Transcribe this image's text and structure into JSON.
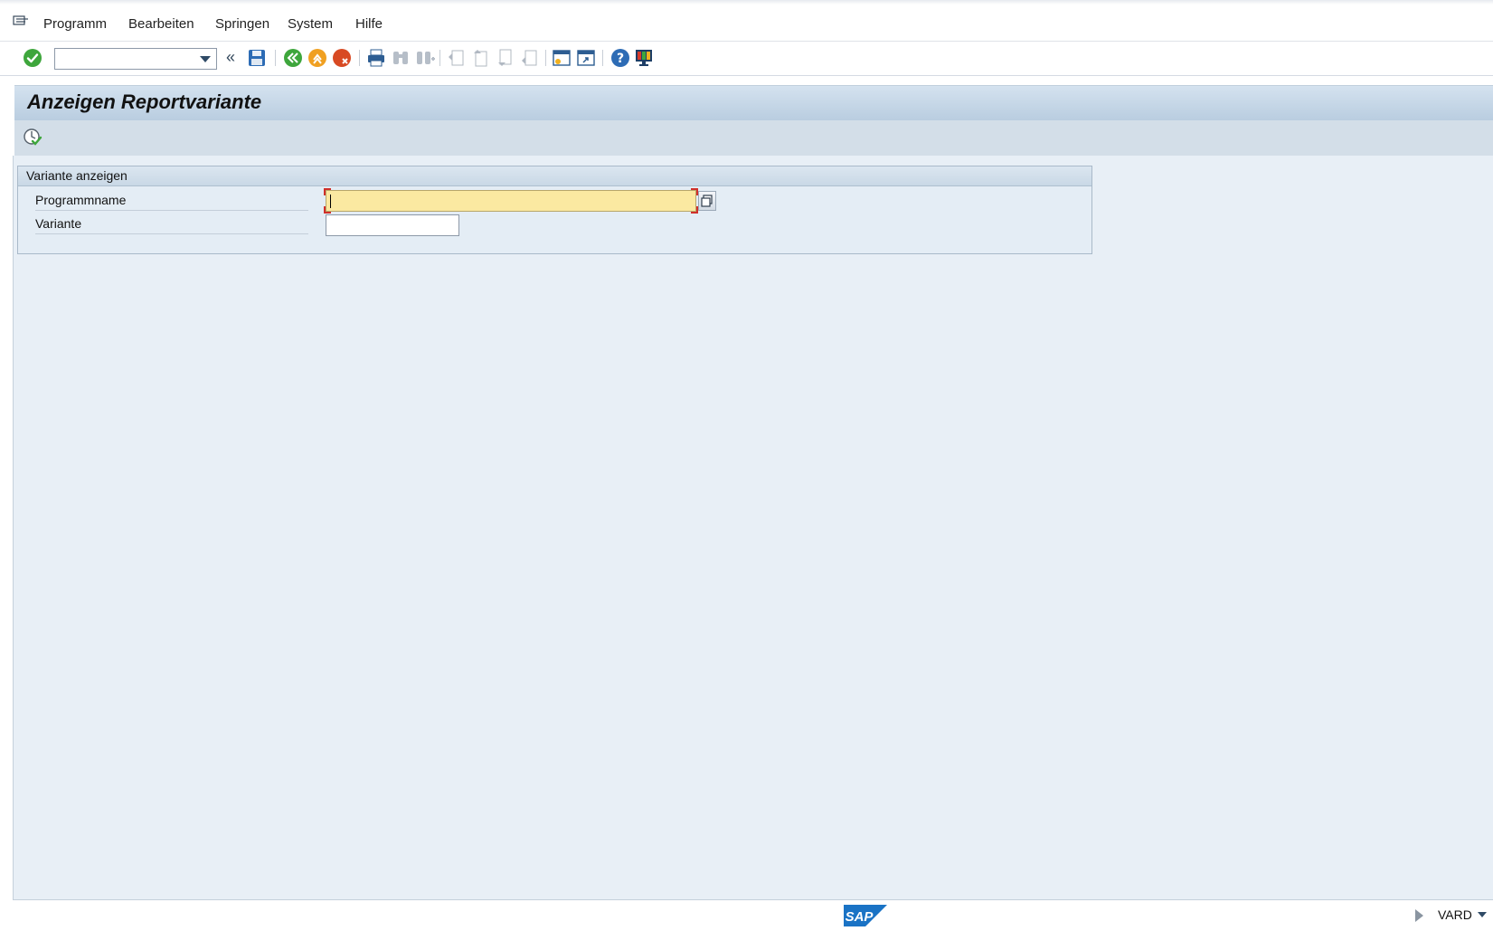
{
  "menu": {
    "items": [
      {
        "label": "Programm"
      },
      {
        "label": "Bearbeiten"
      },
      {
        "label": "Springen"
      },
      {
        "label": "System"
      },
      {
        "label": "Hilfe"
      }
    ]
  },
  "toolbar": {
    "command_field": {
      "value": "",
      "placeholder": ""
    },
    "icons": [
      "enter-icon",
      "back-fast-icon",
      "save-icon",
      "back-icon",
      "exit-icon",
      "cancel-icon",
      "print-icon",
      "find-icon",
      "find-next-icon",
      "first-page-icon",
      "previous-page-icon",
      "next-page-icon",
      "last-page-icon",
      "new-session-icon",
      "shortcut-icon",
      "help-icon",
      "customize-layout-icon"
    ],
    "chevron": "«"
  },
  "title": {
    "text": "Anzeigen Reportvariante"
  },
  "app_toolbar": {
    "icons": [
      "execute-icon"
    ]
  },
  "group": {
    "title": "Variante anzeigen",
    "fields": [
      {
        "label": "Programmname",
        "value": ""
      },
      {
        "label": "Variante",
        "value": ""
      }
    ]
  },
  "statusbar": {
    "logo": "SAP",
    "system": "VARD"
  },
  "colors": {
    "title_band": "#c4d6e7",
    "main_background": "#e8eff6",
    "required_field": "#fbe9a1",
    "enter_green": "#3ea63c",
    "exit_orange": "#f0a021",
    "cancel_red": "#d84a23",
    "sap_blue": "#1a73c5"
  }
}
